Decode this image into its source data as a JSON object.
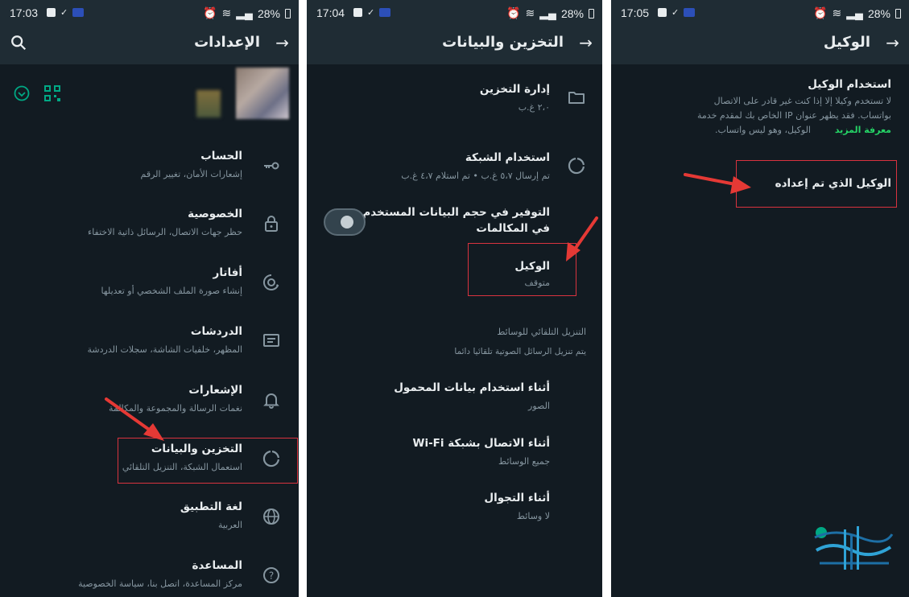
{
  "colors": {
    "screen_bg": "#121b22",
    "appbar_bg": "#1f2c34",
    "text_primary": "#e9edef",
    "text_secondary": "#8696a0",
    "accent_green": "#00a884",
    "highlight_red": "#d9333f",
    "link_green": "#25d366"
  },
  "screen1": {
    "status": {
      "time": "17:03",
      "battery": "28%"
    },
    "title": "الإعدادات",
    "items": [
      {
        "title": "الحساب",
        "subtitle": "إشعارات الأمان، تغيير الرقم",
        "icon": "key-icon"
      },
      {
        "title": "الخصوصية",
        "subtitle": "حظر جهات الاتصال، الرسائل ذاتية الاختفاء",
        "icon": "lock-icon"
      },
      {
        "title": "أفاتار",
        "subtitle": "إنشاء صورة الملف الشخصي أو تعديلها",
        "icon": "avatar-face-icon"
      },
      {
        "title": "الدردشات",
        "subtitle": "المظهر، خلفيات الشاشة، سجلات الدردشة",
        "icon": "chat-icon"
      },
      {
        "title": "الإشعارات",
        "subtitle": "نغمات الرسالة والمجموعة والمكالمة",
        "icon": "bell-icon"
      },
      {
        "title": "التخزين والبيانات",
        "subtitle": "استعمال الشبكة، التنزيل التلقائي",
        "icon": "data-usage-icon"
      },
      {
        "title": "لغة التطبيق",
        "subtitle": "العربية",
        "icon": "globe-icon"
      },
      {
        "title": "المساعدة",
        "subtitle": "مركز المساعدة، اتصل بنا، سياسة الخصوصية",
        "icon": "help-icon"
      }
    ]
  },
  "screen2": {
    "status": {
      "time": "17:04",
      "battery": "28%"
    },
    "title": "التخزين والبيانات",
    "manage_storage": {
      "title": "إدارة التخزين",
      "subtitle": "٢،٠ غ.ب"
    },
    "network_usage": {
      "title": "استخدام الشبكة",
      "subtitle": "تم إرسال ٥،٧ غ.ب • تم استلام ٤،٧ غ.ب"
    },
    "call_saver": {
      "title_line1": "التوفير في حجم البيانات المستخدم",
      "title_line2": "في المكالمات",
      "enabled": false
    },
    "proxy": {
      "title": "الوكيل",
      "subtitle": "متوقف"
    },
    "auto_download": {
      "header": "التنزيل التلقائي للوسائط",
      "note": "يتم تنزيل الرسائل الصوتية تلقائيا دائما"
    },
    "mobile_data": {
      "title": "أثناء استخدام بيانات المحمول",
      "subtitle": "الصور"
    },
    "wifi": {
      "title": "أثناء الاتصال بشبكة Wi-Fi",
      "subtitle": "جميع الوسائط"
    },
    "roaming": {
      "title": "أثناء التجوال",
      "subtitle": "لا وسائط"
    }
  },
  "screen3": {
    "status": {
      "time": "17:05",
      "battery": "28%"
    },
    "title": "الوكيل",
    "use_proxy": {
      "title": "استخدام الوكيل",
      "line1": "لا تستخدم وكيلا إلا إذا كنت غير قادر على الاتصال",
      "line2": "بواتساب. فقد يظهر عنوان IP الخاص بك لمقدم خدمة",
      "line3": "الوكيل، وهو ليس واتساب.",
      "learn_more": "معرفة المزيد"
    },
    "configured_proxy": "الوكيل الذي تم إعداده"
  }
}
